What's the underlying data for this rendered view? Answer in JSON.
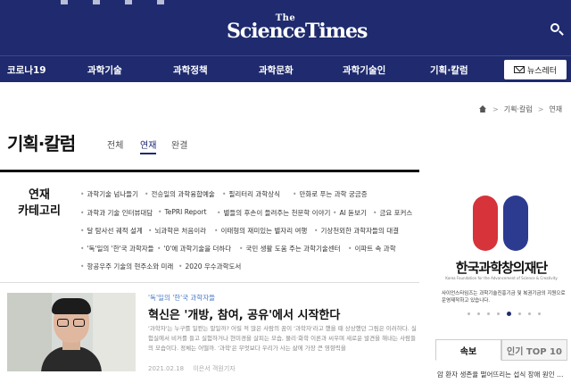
{
  "header": {
    "logo_the": "The",
    "logo_main": "ScienceTimes"
  },
  "nav": {
    "items": [
      "코로나19",
      "과학기술",
      "과학정책",
      "과학문화",
      "과학기술인",
      "기획·칼럼"
    ],
    "newsletter_label": "뉴스레터"
  },
  "breadcrumb": [
    "기획·칼럼",
    "연재"
  ],
  "page": {
    "title": "기획·칼럼",
    "tabs": [
      "전체",
      "연재",
      "완결"
    ],
    "active_tab": "연재"
  },
  "categories": {
    "title_line1": "연재",
    "title_line2": "카테고리",
    "items": [
      "과학기술 넘나들기",
      "전승일의 과학융합예술",
      "필리터리 과학상식",
      "만화로 푸는 과학 궁금증",
      "과학과 기술 인터뷰대담",
      "TePRI Report",
      "별들의 후손이 들려주는 천문학 이야기",
      "AI 돋보기",
      "금요 포커스",
      "달 탐사선 궤적 설계",
      "뇌과학은 처음이라",
      "이태형의 재미있는 별자리 여행",
      "기상천외한 과학자들의 대결",
      "'독'일의 '한'국 과학자들",
      "'0'에 과학기술을 더하다",
      "국민 생활 도움 주는 과학기술센터",
      "이파트 속 과학",
      "항공우주 기술의 현주소와 미래",
      "2020 우수과학도서"
    ]
  },
  "article": {
    "category": "'독'일의 '한'국 과학자들",
    "title": "혁신은 '개방, 참여, 공유'에서 시작한다",
    "summary": "'과학자'는 누구를 일컫는 말일까? 어릴 적 많은 사람의 꿈이 '과학자'라고 했을 때 상상했던 그림은 이러하다. 실험실에서 비커를 들고 실험하거나 현미경을 살피는 모습, 물리·화학 이론과 씨우며 새로운 발견을 해내는 사람들의 모습이다. 정체는 어떨까. '과학'은 무엇보다 우리가 사는 삶에 가장 큰 영향력을",
    "date": "2021.02.18",
    "author": "이은서 객원기자"
  },
  "ad": {
    "org_name": "한국과학창의재단",
    "org_en": "Korea Foundation for the Advancement of Science & Creativity",
    "note": "사이언스타임즈는 과학기술진흥기금 및 복권기금의 지원으로 운영제작하고 있습니다."
  },
  "sidebar": {
    "tabs": [
      "속보",
      "인기 TOP 10"
    ],
    "active_tab": "속보",
    "first_item": "암 환자 생존율 떨어뜨리는 섭식 장애 원인 …"
  },
  "colors": {
    "brand_navy": "#1f2b6e",
    "category_blue": "#4a7ac7",
    "ad_red": "#d6333a",
    "ad_blue": "#2c3b90"
  },
  "icons": [
    "search-icon",
    "envelope-icon",
    "home-icon"
  ]
}
